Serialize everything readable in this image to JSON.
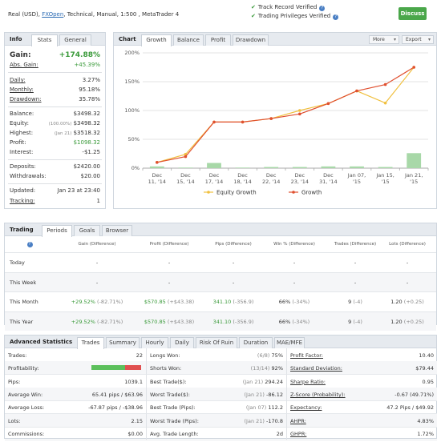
{
  "header": {
    "account_prefix": "Real (USD),",
    "broker_link": "FXOpen",
    "account_suffix": ", Technical, Manual, 1:500 , MetaTrader 4",
    "track_record": "Track Record Verified",
    "trading_privileges": "Trading Privileges Verified",
    "discuss_label": "Discuss"
  },
  "info": {
    "title": "Info",
    "tabs": [
      "Stats",
      "General"
    ],
    "gain_label": "Gain:",
    "gain_value": "+174.88%",
    "abs_gain_label": "Abs. Gain:",
    "abs_gain_value": "+45.39%",
    "daily_label": "Daily:",
    "daily_value": "3.27%",
    "monthly_label": "Monthly:",
    "monthly_value": "95.18%",
    "drawdown_label": "Drawdown:",
    "drawdown_value": "35.78%",
    "balance_label": "Balance:",
    "balance_value": "$3498.32",
    "equity_label": "Equity:",
    "equity_note": "(100.00%)",
    "equity_value": "$3498.32",
    "highest_label": "Highest:",
    "highest_note": "(Jan 21)",
    "highest_value": "$3518.32",
    "profit_label": "Profit:",
    "profit_value": "$1098.32",
    "interest_label": "Interest:",
    "interest_value": "-$1.25",
    "deposits_label": "Deposits:",
    "deposits_value": "$2420.00",
    "withdrawals_label": "Withdrawals:",
    "withdrawals_value": "$20.00",
    "updated_label": "Updated:",
    "updated_value": "Jan 23 at 23:40",
    "tracking_label": "Tracking:",
    "tracking_value": "1"
  },
  "chart_panel": {
    "title": "Chart",
    "tabs": [
      "Growth",
      "Balance",
      "Profit",
      "Drawdown"
    ],
    "more_label": "More",
    "export_label": "Export"
  },
  "chart_data": {
    "type": "line",
    "categories": [
      "Dec 11, '14",
      "Dec 15, '14",
      "Dec 17, '14",
      "Dec 18, '14",
      "Dec 22, '14",
      "Dec 23, '14",
      "Dec 31, '14",
      "Jan 07, '15",
      "Jan 15, '15",
      "Jan 21, '15"
    ],
    "tick_line1": [
      "Dec",
      "Dec",
      "Dec",
      "Dec",
      "Dec",
      "Dec",
      "Dec",
      "Jan 07,",
      "Jan 15,",
      "Jan 21,"
    ],
    "tick_line2": [
      "11, '14",
      "15, '14",
      "17, '14",
      "18, '14",
      "22, '14",
      "23, '14",
      "31, '14",
      "'15",
      "'15",
      "'15"
    ],
    "series": [
      {
        "name": "Equity Growth",
        "color": "#f0c040",
        "values": [
          10,
          24,
          80,
          80,
          86,
          100,
          112,
          134,
          113,
          175
        ]
      },
      {
        "name": "Growth",
        "color": "#e05030",
        "values": [
          10,
          20,
          80,
          80,
          86,
          94,
          112,
          134,
          145,
          175
        ]
      }
    ],
    "bars": {
      "color": "#a8d8a8",
      "values": [
        3,
        1,
        9,
        1,
        2,
        2,
        3,
        3,
        2,
        26
      ]
    },
    "yticks": [
      "0%",
      "50%",
      "100%",
      "150%",
      "200%"
    ],
    "ylim": [
      0,
      200
    ],
    "grid": true,
    "legend": "bottom"
  },
  "trading": {
    "title": "Trading",
    "tabs": [
      "Periods",
      "Goals",
      "Browser"
    ],
    "help_icon": "?",
    "columns": [
      "Gain (Difference)",
      "Profit (Difference)",
      "Pips (Difference)",
      "Win % (Difference)",
      "Trades (Difference)",
      "Lots (Difference)"
    ],
    "rows": [
      {
        "label": "Today",
        "gain": "-",
        "gain_diff": "",
        "profit": "-",
        "profit_diff": "",
        "pips": "-",
        "pips_diff": "",
        "win": "-",
        "win_diff": "",
        "trades": "-",
        "trades_diff": "",
        "lots": "-",
        "lots_diff": ""
      },
      {
        "label": "This Week",
        "gain": "-",
        "gain_diff": "",
        "profit": "-",
        "profit_diff": "",
        "pips": "-",
        "pips_diff": "",
        "win": "-",
        "win_diff": "",
        "trades": "-",
        "trades_diff": "",
        "lots": "-",
        "lots_diff": ""
      },
      {
        "label": "This Month",
        "gain": "+29.52%",
        "gain_diff": "(-82.71%)",
        "profit": "$570.85",
        "profit_diff": "(+$43.38)",
        "pips": "341.10",
        "pips_diff": "(-356.9)",
        "win": "66%",
        "win_diff": "(-34%)",
        "trades": "9",
        "trades_diff": "(-4)",
        "lots": "1.20",
        "lots_diff": "(+0.25)"
      },
      {
        "label": "This Year",
        "gain": "+29.52%",
        "gain_diff": "(-82.71%)",
        "profit": "$570.85",
        "profit_diff": "(+$43.38)",
        "pips": "341.10",
        "pips_diff": "(-356.9)",
        "win": "66%",
        "win_diff": "(-34%)",
        "trades": "9",
        "trades_diff": "(-4)",
        "lots": "1.20",
        "lots_diff": "(+0.25)"
      }
    ]
  },
  "advanced": {
    "title": "Advanced Statistics",
    "tabs": [
      "Trades",
      "Summary",
      "Hourly",
      "Daily",
      "Risk Of Ruin",
      "Duration",
      "MAE/MFE"
    ],
    "col1": [
      {
        "label": "Trades:",
        "value": "22"
      },
      {
        "label": "Profitability:",
        "value": ""
      },
      {
        "label": "Pips:",
        "value": "1039.1"
      },
      {
        "label": "Average Win:",
        "value": "65.41 pips / $63.96"
      },
      {
        "label": "Average Loss:",
        "value": "-67.87 pips / -$38.96"
      },
      {
        "label": "Lots:",
        "value": "2.15"
      },
      {
        "label": "Commissions:",
        "value": "$0.00"
      }
    ],
    "profitability_win_fraction": 0.68,
    "col2": [
      {
        "label": "Longs Won:",
        "note": "(6/8)",
        "value": "75%"
      },
      {
        "label": "Shorts Won:",
        "note": "(13/14)",
        "value": "92%"
      },
      {
        "label": "Best Trade($):",
        "note": "(Jan 21)",
        "value": "294.24"
      },
      {
        "label": "Worst Trade($):",
        "note": "(Jan 21)",
        "value": "-86.12"
      },
      {
        "label": "Best Trade (Pips):",
        "note": "(Jan 07)",
        "value": "112.2"
      },
      {
        "label": "Worst Trade (Pips):",
        "note": "(Jan 21)",
        "value": "-170.8"
      },
      {
        "label": "Avg. Trade Length:",
        "note": "",
        "value": "2d"
      }
    ],
    "col3": [
      {
        "label": "Profit Factor:",
        "value": "10.40"
      },
      {
        "label": "Standard Deviation:",
        "value": "$79.44"
      },
      {
        "label": "Sharpe Ratio:",
        "value": "0.95"
      },
      {
        "label": "Z-Score (Probability):",
        "value": "-0.67 (49.71%)"
      },
      {
        "label": "Expectancy:",
        "value": "47.2 Pips / $49.92"
      },
      {
        "label": "AHPR:",
        "value": "4.83%"
      },
      {
        "label": "GHPR:",
        "value": "1.72%"
      }
    ]
  }
}
